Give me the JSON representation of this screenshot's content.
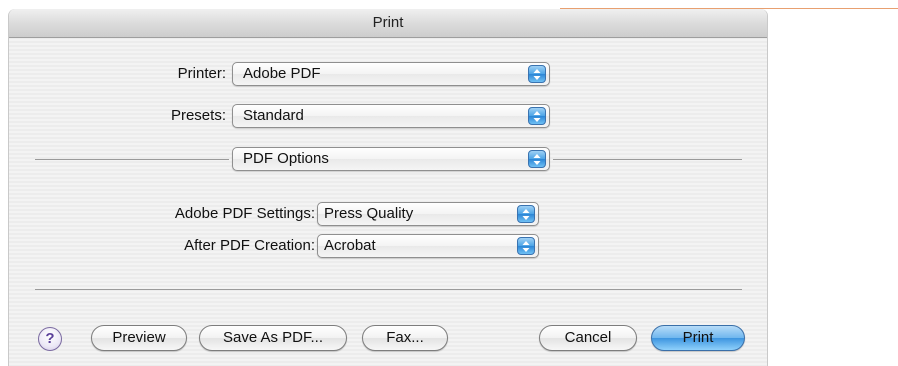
{
  "window": {
    "title": "Print"
  },
  "printer": {
    "label": "Printer:",
    "value": "Adobe PDF"
  },
  "presets": {
    "label": "Presets:",
    "value": "Standard"
  },
  "section": {
    "value": "PDF Options"
  },
  "pdf_settings": {
    "label": "Adobe PDF Settings:",
    "value": "Press Quality"
  },
  "after_creation": {
    "label": "After PDF Creation:",
    "value": "Acrobat"
  },
  "buttons": {
    "help": "?",
    "preview": "Preview",
    "save_as_pdf": "Save As PDF...",
    "fax": "Fax...",
    "cancel": "Cancel",
    "print": "Print"
  },
  "colors": {
    "accent": "#4aa3e6",
    "default_button": "#6fb6ee",
    "help_icon": "#5a3f9a"
  }
}
